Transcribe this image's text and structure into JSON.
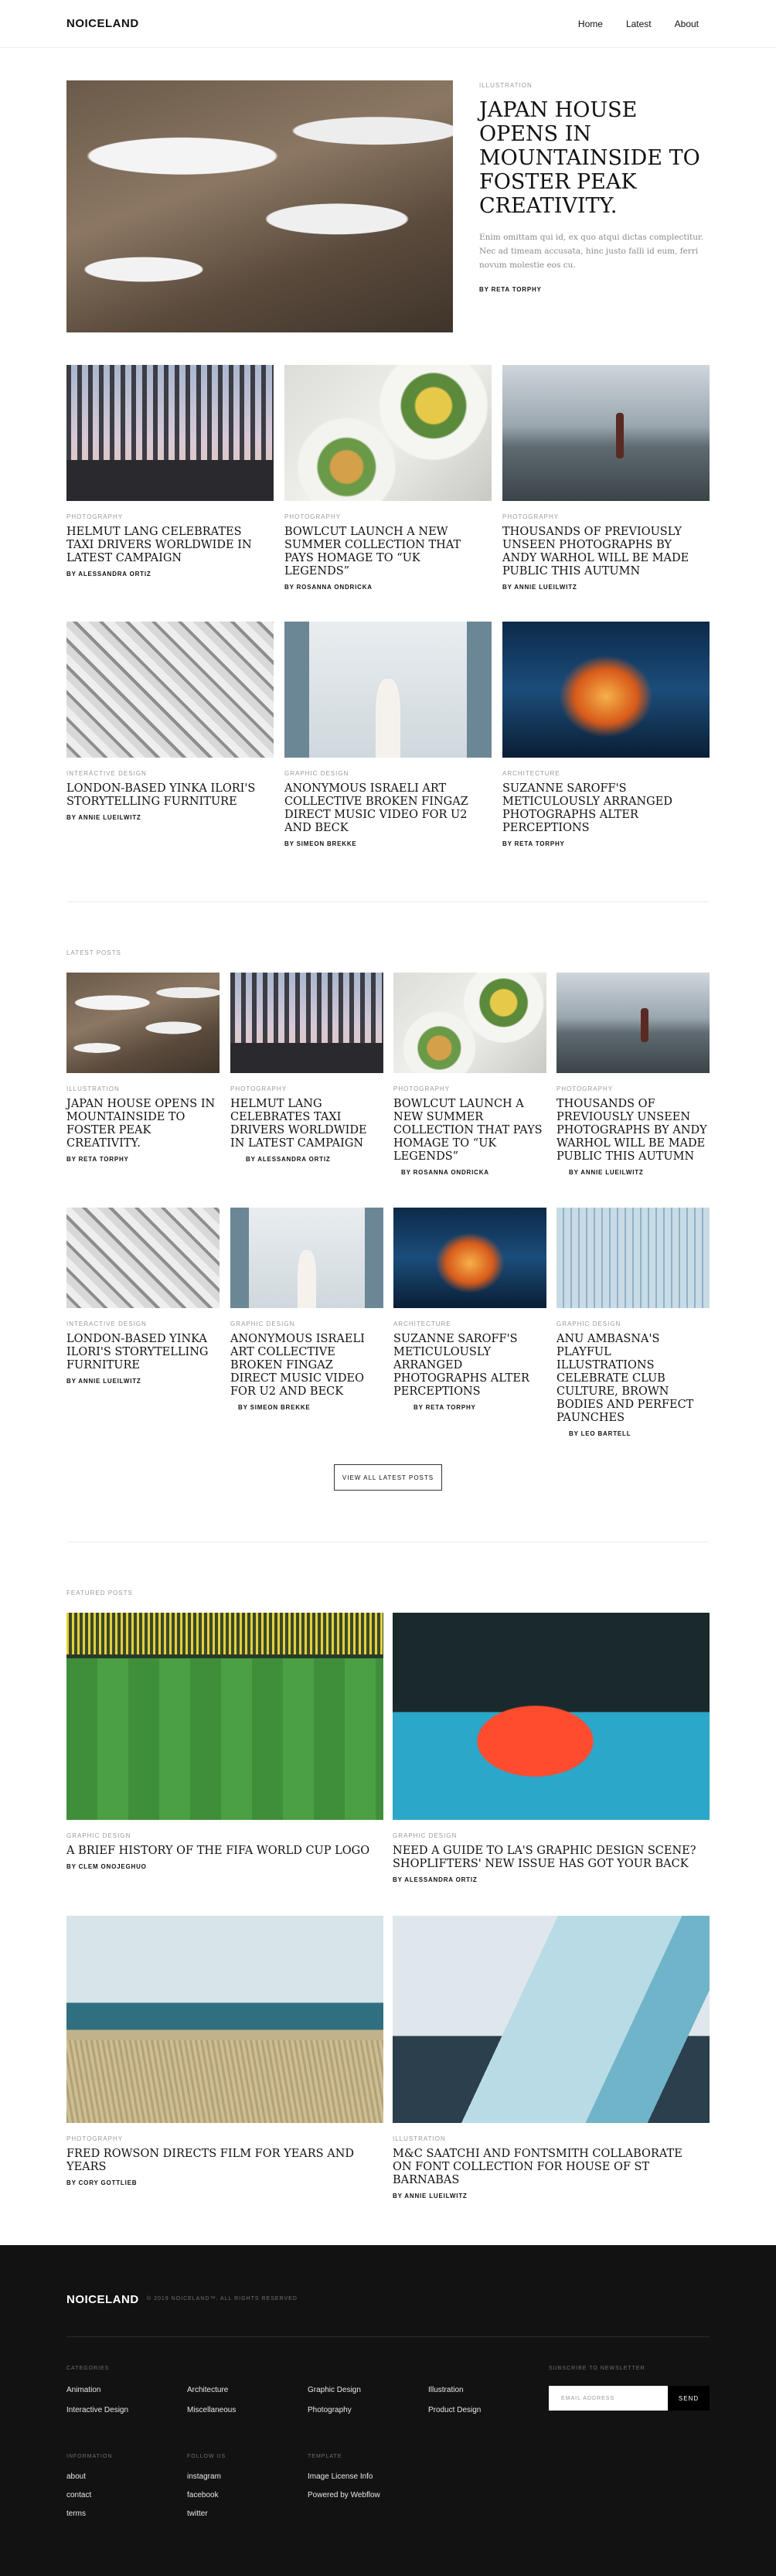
{
  "header": {
    "logo": "NOICELAND",
    "nav": [
      "Home",
      "Latest",
      "About"
    ]
  },
  "hero": {
    "category": "ILLUSTRATION",
    "title": "JAPAN HOUSE OPENS IN MOUNTAINSIDE TO FOSTER PEAK CREATIVITY.",
    "excerpt": "Enim omittam qui id, ex quo atqui dictas complectitur. Nec ad timeam accusata, hinc justo falli id eum, ferri novum molestie eos cu.",
    "author": "BY RETA TORPHY"
  },
  "grid1": [
    {
      "category": "PHOTOGRAPHY",
      "title": "HELMUT LANG CELEBRATES TAXI DRIVERS WORLDWIDE IN LATEST CAMPAIGN",
      "author": "BY ALESSANDRA ORTIZ"
    },
    {
      "category": "PHOTOGRAPHY",
      "title": "BOWLCUT LAUNCH A NEW SUMMER COLLECTION THAT PAYS HOMAGE TO “UK LEGENDS”",
      "author": "BY ROSANNA ONDRICKA"
    },
    {
      "category": "PHOTOGRAPHY",
      "title": "THOUSANDS OF PREVIOUSLY UNSEEN PHOTOGRAPHS BY ANDY WARHOL WILL BE MADE PUBLIC THIS AUTUMN",
      "author": "BY ANNIE LUEILWITZ"
    },
    {
      "category": "INTERACTIVE DESIGN",
      "title": "LONDON-BASED YINKA ILORI'S STORYTELLING FURNITURE",
      "author": "BY ANNIE LUEILWITZ"
    },
    {
      "category": "GRAPHIC DESIGN",
      "title": "ANONYMOUS ISRAELI ART COLLECTIVE BROKEN FINGAZ DIRECT MUSIC VIDEO FOR U2 AND BECK",
      "author": "BY SIMEON BREKKE"
    },
    {
      "category": "ARCHITECTURE",
      "title": "SUZANNE SAROFF'S METICULOUSLY ARRANGED PHOTOGRAPHS ALTER PERCEPTIONS",
      "author": "BY RETA TORPHY"
    }
  ],
  "latest": {
    "heading": "LATEST POSTS",
    "posts": [
      {
        "category": "ILLUSTRATION",
        "title": "JAPAN HOUSE OPENS IN MOUNTAINSIDE TO FOSTER PEAK CREATIVITY.",
        "author": "BY RETA TORPHY"
      },
      {
        "category": "PHOTOGRAPHY",
        "title": "HELMUT LANG CELEBRATES TAXI DRIVERS WORLDWIDE IN LATEST CAMPAIGN",
        "author": "BY ALESSANDRA ORTIZ"
      },
      {
        "category": "PHOTOGRAPHY",
        "title": "BOWLCUT LAUNCH A NEW SUMMER COLLECTION THAT PAYS HOMAGE TO “UK LEGENDS”",
        "author": "BY ROSANNA ONDRICKA"
      },
      {
        "category": "PHOTOGRAPHY",
        "title": "THOUSANDS OF PREVIOUSLY UNSEEN PHOTOGRAPHS BY ANDY WARHOL WILL BE MADE PUBLIC THIS AUTUMN",
        "author": "BY ANNIE LUEILWITZ"
      },
      {
        "category": "INTERACTIVE DESIGN",
        "title": "LONDON-BASED YINKA ILORI'S STORYTELLING FURNITURE",
        "author": "BY ANNIE LUEILWITZ"
      },
      {
        "category": "GRAPHIC DESIGN",
        "title": "ANONYMOUS ISRAELI ART COLLECTIVE BROKEN FINGAZ DIRECT MUSIC VIDEO FOR U2 AND BECK",
        "author": "BY SIMEON BREKKE"
      },
      {
        "category": "ARCHITECTURE",
        "title": "SUZANNE SAROFF'S METICULOUSLY ARRANGED PHOTOGRAPHS ALTER PERCEPTIONS",
        "author": "BY RETA TORPHY"
      },
      {
        "category": "GRAPHIC DESIGN",
        "title": "ANU AMBASNA'S PLAYFUL ILLUSTRATIONS CELEBRATE CLUB CULTURE, BROWN BODIES AND PERFECT PAUNCHES",
        "author": "BY LEO BARTELL"
      }
    ],
    "button": "VIEW ALL LATEST POSTS"
  },
  "featured": {
    "heading": "FEATURED POSTS",
    "posts": [
      {
        "category": "GRAPHIC DESIGN",
        "title": "A BRIEF HISTORY OF THE FIFA WORLD CUP LOGO",
        "author": "BY CLEM ONOJEGHUO"
      },
      {
        "category": "GRAPHIC DESIGN",
        "title": "NEED A GUIDE TO LA'S GRAPHIC DESIGN SCENE? SHOPLIFTERS' NEW ISSUE HAS GOT YOUR BACK",
        "author": "BY ALESSANDRA ORTIZ"
      },
      {
        "category": "PHOTOGRAPHY",
        "title": "FRED ROWSON DIRECTS FILM FOR YEARS AND YEARS",
        "author": "BY CORY GOTTLIEB"
      },
      {
        "category": "ILLUSTRATION",
        "title": "M&C SAATCHI AND FONTSMITH COLLABORATE ON FONT COLLECTION FOR HOUSE OF ST BARNABAS",
        "author": "BY ANNIE LUEILWITZ"
      }
    ]
  },
  "footer": {
    "logo": "NOICELAND",
    "copyright": "© 2019 NOICELAND™. ALL RIGHTS RESERVED",
    "categories_heading": "CATEGORIES",
    "categories": [
      "Animation",
      "Architecture",
      "Graphic Design",
      "Illustration",
      "Interactive Design",
      "Miscellaneous",
      "Photography",
      "Product Design"
    ],
    "newsletter_heading": "SUBSCRIBE TO NEWSLETTER",
    "email_placeholder": "EMAIL ADDRESS",
    "send": "SEND",
    "information_heading": "INFORMATION",
    "information": [
      "about",
      "contact",
      "terms"
    ],
    "follow_heading": "FOLLOW US",
    "follow": [
      "instagram",
      "facebook",
      "twitter"
    ],
    "template_heading": "TEMPLATE",
    "template": [
      "Image License Info",
      "Powered by Webflow"
    ]
  }
}
